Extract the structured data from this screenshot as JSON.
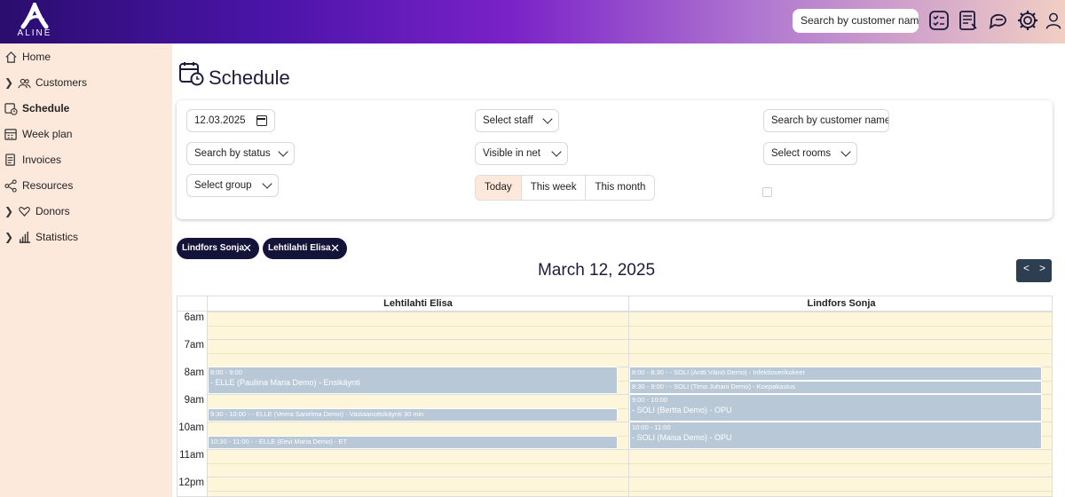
{
  "header": {
    "logo_text": "ALINE",
    "search_placeholder": "Search by customer name",
    "icons": [
      "checklist-icon",
      "document-icon",
      "chat-icon",
      "gear-icon",
      "user-icon"
    ]
  },
  "sidebar": {
    "items": [
      {
        "label": "Home",
        "icon": "home-icon",
        "chevron": false,
        "active": false
      },
      {
        "label": "Customers",
        "icon": "people-icon",
        "chevron": true,
        "active": false
      },
      {
        "label": "Schedule",
        "icon": "calendar-clock-icon",
        "chevron": false,
        "active": true
      },
      {
        "label": "Week plan",
        "icon": "week-calendar-icon",
        "chevron": false,
        "active": false
      },
      {
        "label": "Invoices",
        "icon": "invoice-icon",
        "chevron": false,
        "active": false
      },
      {
        "label": "Resources",
        "icon": "share-nodes-icon",
        "chevron": false,
        "active": false
      },
      {
        "label": "Donors",
        "icon": "donor-icon",
        "chevron": true,
        "active": false
      },
      {
        "label": "Statistics",
        "icon": "bar-chart-icon",
        "chevron": true,
        "active": false
      }
    ]
  },
  "page": {
    "title": "Schedule"
  },
  "filters": {
    "date": "12.03.2025",
    "status": "Search by status",
    "group": "Select group",
    "staff": "Select staff",
    "visible_in_net": "Visible in net",
    "customer_search": "Search by customer name",
    "rooms": "Select rooms",
    "range": [
      "Today",
      "This week",
      "This month"
    ],
    "range_selected": "Today"
  },
  "chips": [
    "Lindfors Sonja",
    "Lehtilahti Elisa"
  ],
  "schedule": {
    "date_heading": "March 12, 2025",
    "prev_label": "<",
    "next_label": ">",
    "hours": [
      "6am",
      "7am",
      "8am",
      "9am",
      "10am",
      "11am",
      "12pm"
    ],
    "columns": [
      {
        "name": "Lehtilahti Elisa",
        "events": [
          {
            "time": "8:00 - 9:00",
            "text": "- ELLE (Pauliina Maria Demo) - Ensikäynti",
            "start": 8.0,
            "end": 9.0
          },
          {
            "time": "",
            "text": "9:30 - 10:00 - - ELLE (Veera Sanelma Demo) - Vastaanottokäynti 30 min",
            "start": 9.5,
            "end": 10.0
          },
          {
            "time": "",
            "text": "10:30 - 11:00 - - ELLE (Eevi Maria Demo) - ET",
            "start": 10.5,
            "end": 11.0
          }
        ]
      },
      {
        "name": "Lindfors Sonja",
        "events": [
          {
            "time": "",
            "text": "8:00 - 8:30 - - SOLI (Antti Väinö Demo) - Infektioverikokeet",
            "start": 8.0,
            "end": 8.5
          },
          {
            "time": "",
            "text": "8:30 - 9:00 - - SOLI (Timo Juhani Demo) - Koepakastus",
            "start": 8.5,
            "end": 9.0
          },
          {
            "time": "9:00 - 10:00",
            "text": "- SOLI (Bertta Demo) - OPU",
            "start": 9.0,
            "end": 10.0
          },
          {
            "time": "10:00 - 11:00",
            "text": "- SOLI (Maisa Demo) - OPU",
            "start": 10.0,
            "end": 11.0
          }
        ]
      }
    ]
  }
}
